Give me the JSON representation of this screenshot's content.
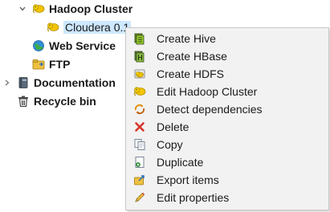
{
  "tree": {
    "hadoop_cluster": "Hadoop Cluster",
    "cloudera": "Cloudera 0.1",
    "web_service": "Web Service",
    "ftp": "FTP",
    "documentation": "Documentation",
    "recycle_bin": "Recycle bin"
  },
  "menu": {
    "items": [
      {
        "label": "Create Hive",
        "icon": "hive-icon"
      },
      {
        "label": "Create HBase",
        "icon": "hbase-icon"
      },
      {
        "label": "Create HDFS",
        "icon": "hdfs-icon"
      },
      {
        "label": "Edit Hadoop Cluster",
        "icon": "hadoop-elephant-icon"
      },
      {
        "label": "Detect dependencies",
        "icon": "detect-dependencies-icon"
      },
      {
        "label": "Delete",
        "icon": "delete-x-icon"
      },
      {
        "label": "Copy",
        "icon": "copy-icon"
      },
      {
        "label": "Duplicate",
        "icon": "duplicate-icon"
      },
      {
        "label": "Export items",
        "icon": "export-icon"
      },
      {
        "label": "Edit properties",
        "icon": "pencil-icon"
      }
    ]
  },
  "colors": {
    "selection": "#cde8ff",
    "menu_bg": "#f2f2f2",
    "elephant_yellow": "#f2c300",
    "delete_red": "#d9342b"
  }
}
